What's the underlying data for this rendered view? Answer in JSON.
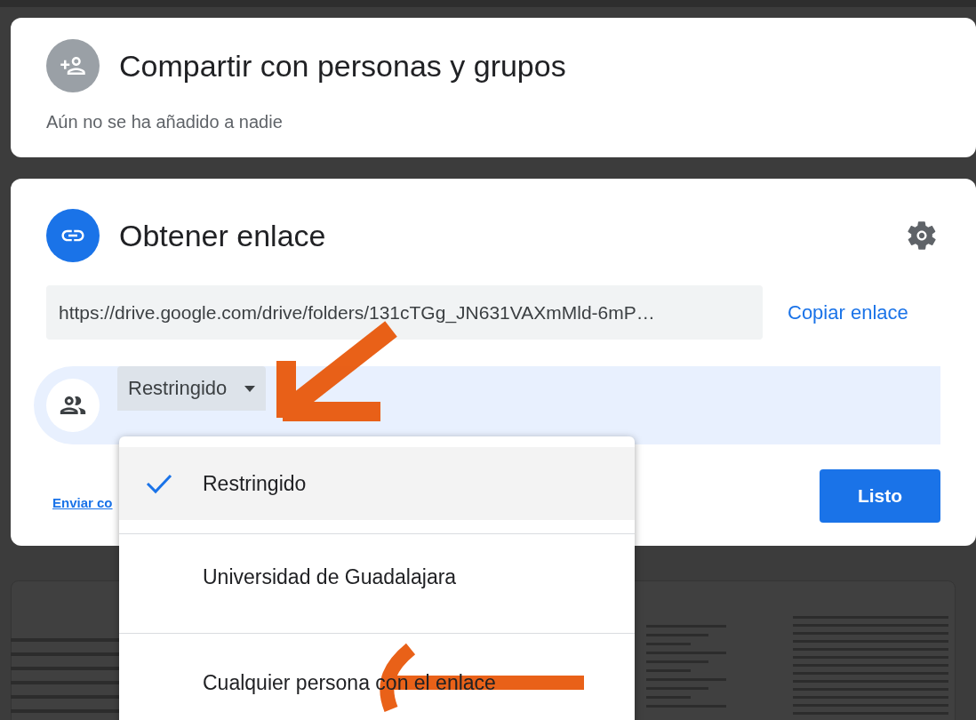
{
  "share_people": {
    "title": "Compartir con personas y grupos",
    "subtitle": "Aún no se ha añadido a nadie"
  },
  "get_link": {
    "title": "Obtener enlace",
    "url": "https://drive.google.com/drive/folders/131cTGg_JN631VAXmMld-6mP…",
    "copy_link": "Copiar enlace",
    "access_current": "Restringido",
    "send_link": "Enviar co",
    "done_button": "Listo"
  },
  "access_menu": [
    {
      "label": "Restringido",
      "selected": true
    },
    {
      "label": "Universidad de Guadalajara",
      "selected": false
    },
    {
      "label": "Cualquier persona con el enlace",
      "selected": false
    }
  ]
}
